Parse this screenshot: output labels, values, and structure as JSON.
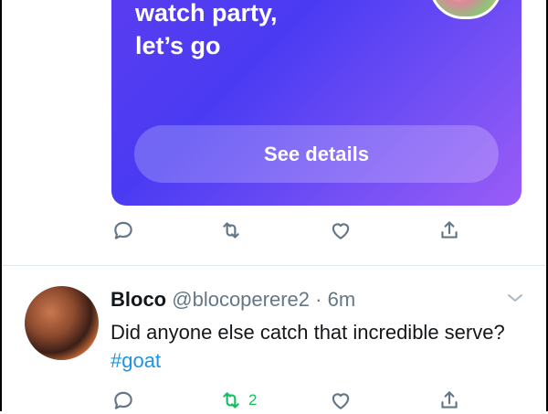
{
  "promo_card": {
    "title_line1": "watch party,",
    "title_line2": "let’s go",
    "cta_label": "See details"
  },
  "promo_actions": {
    "reply_icon": "reply-icon",
    "retweet_icon": "retweet-icon",
    "like_icon": "like-icon",
    "share_icon": "share-icon"
  },
  "tweet": {
    "display_name": "Bloco",
    "handle": "@blocoperere2",
    "separator": "·",
    "time": "6m",
    "text": "Did anyone else catch that incredible serve? ",
    "hashtag": "#goat",
    "retweet_count": "2",
    "colors": {
      "hashtag": "#1b95e0",
      "retweet_active": "#17bf63",
      "muted": "#657786"
    }
  }
}
